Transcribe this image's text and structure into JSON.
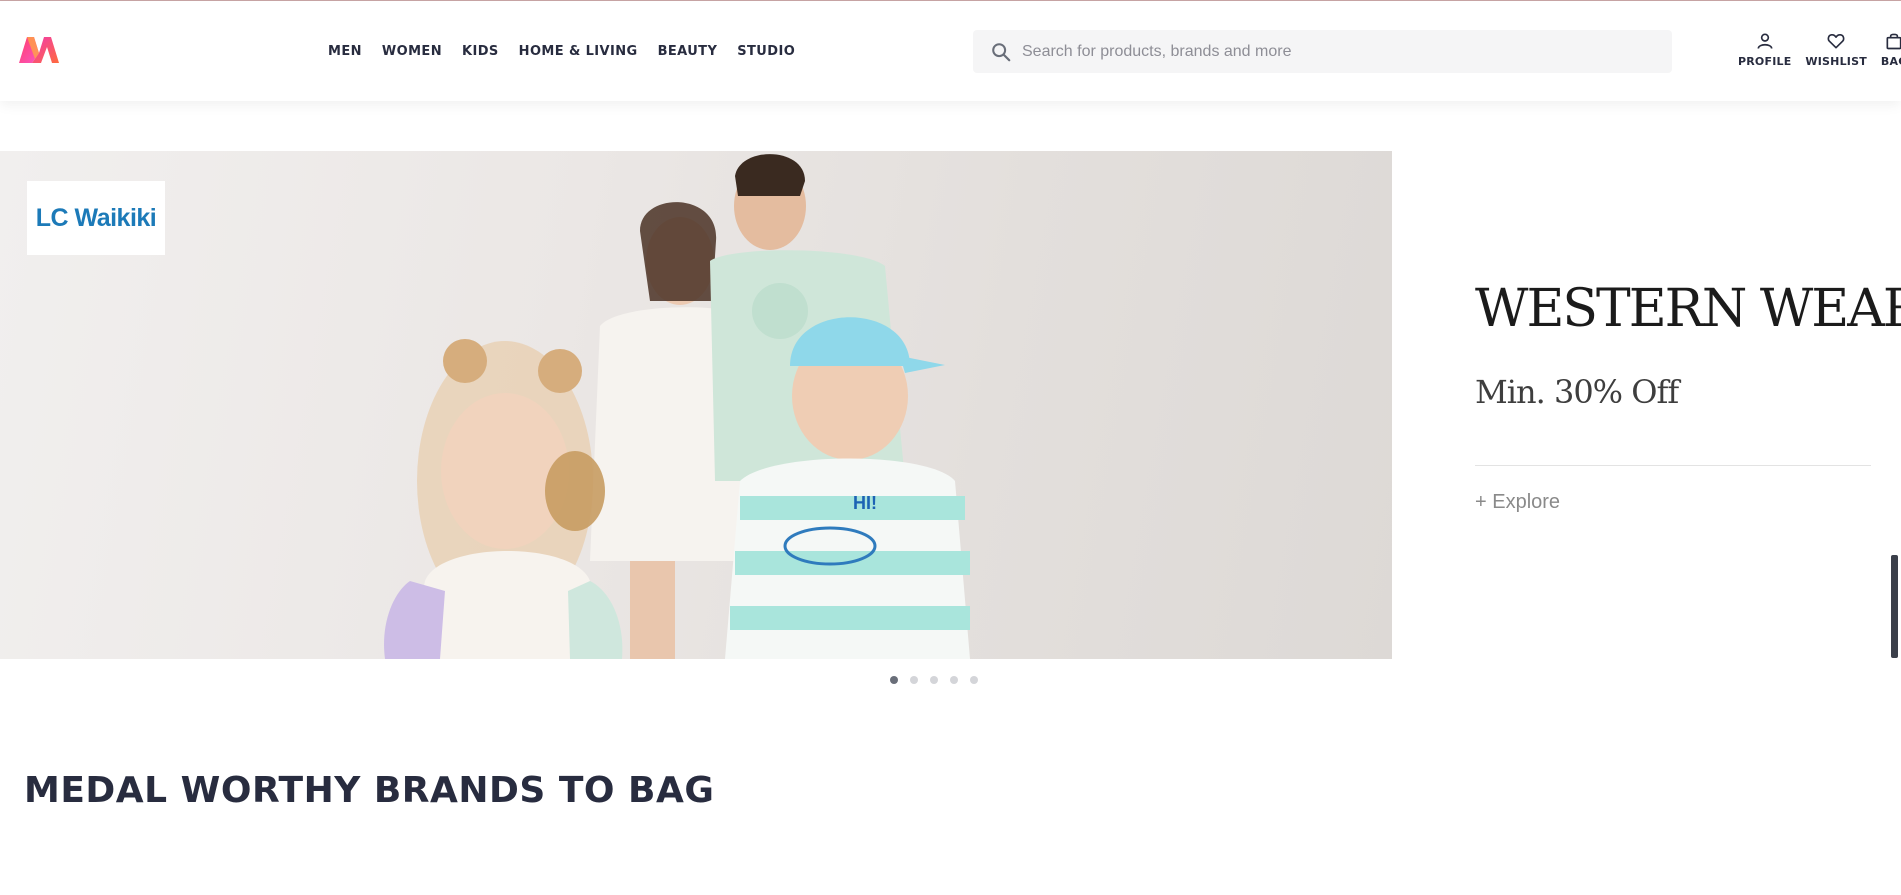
{
  "header": {
    "logo_icon": "myntra-logo",
    "nav": [
      {
        "label": "MEN"
      },
      {
        "label": "WOMEN"
      },
      {
        "label": "KIDS"
      },
      {
        "label": "HOME & LIVING"
      },
      {
        "label": "BEAUTY"
      },
      {
        "label": "STUDIO"
      }
    ],
    "search": {
      "placeholder": "Search for products, brands and more",
      "icon": "search-icon"
    },
    "actions": [
      {
        "label": "PROFILE",
        "icon": "person-icon"
      },
      {
        "label": "WISHLIST",
        "icon": "heart-icon"
      },
      {
        "label": "BAG",
        "icon": "bag-icon"
      }
    ]
  },
  "banner": {
    "brand": "LC Waikiki",
    "title": "WESTERN WEAR",
    "subtitle": "Min. 30% Off",
    "cta": "+ Explore",
    "slide_count": 5,
    "active_slide": 1
  },
  "section": {
    "title": "MEDAL WORTHY BRANDS TO BAG"
  },
  "colors": {
    "brand_logo_blue": "#1c7ab8",
    "text": "#282c3f",
    "search_bg": "#f5f5f6"
  }
}
